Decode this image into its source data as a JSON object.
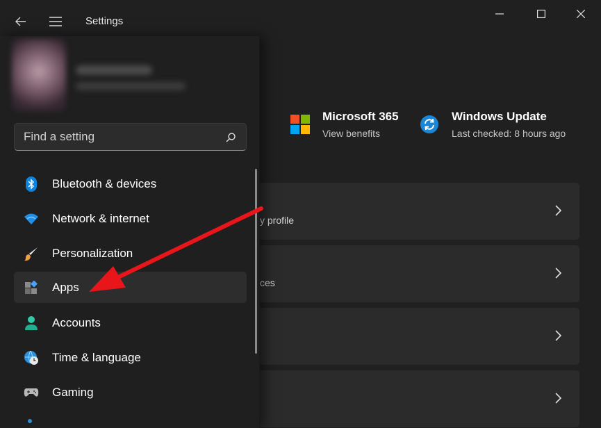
{
  "window": {
    "title": "Settings"
  },
  "promos": [
    {
      "title": "Microsoft 365",
      "subtitle": "View benefits"
    },
    {
      "title": "Windows Update",
      "subtitle": "Last checked: 8 hours ago"
    }
  ],
  "cards": [
    {
      "text": "y profile"
    },
    {
      "text": "ces"
    },
    {
      "text": ""
    },
    {
      "text": ""
    }
  ],
  "search": {
    "placeholder": "Find a setting"
  },
  "nav": [
    {
      "label": "Bluetooth & devices",
      "icon": "bluetooth-icon"
    },
    {
      "label": "Network & internet",
      "icon": "wifi-icon"
    },
    {
      "label": "Personalization",
      "icon": "brush-icon"
    },
    {
      "label": "Apps",
      "icon": "apps-icon",
      "selected": true
    },
    {
      "label": "Accounts",
      "icon": "person-icon"
    },
    {
      "label": "Time & language",
      "icon": "globe-clock-icon"
    },
    {
      "label": "Gaming",
      "icon": "gamepad-icon"
    }
  ],
  "colors": {
    "accent": "#0078d4",
    "annotation_arrow": "#e8161a"
  }
}
